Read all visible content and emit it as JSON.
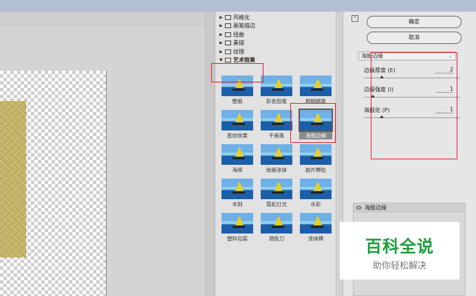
{
  "tree": [
    {
      "label": "风格化",
      "open": false
    },
    {
      "label": "画笔描边",
      "open": false
    },
    {
      "label": "扭曲",
      "open": false
    },
    {
      "label": "素描",
      "open": false
    },
    {
      "label": "纹理",
      "open": false
    },
    {
      "label": "艺术效果",
      "open": true
    }
  ],
  "thumbnails": [
    {
      "label": "壁画"
    },
    {
      "label": "彩色铅笔"
    },
    {
      "label": "粗糙蜡笔"
    },
    {
      "label": "底纹效果"
    },
    {
      "label": "干画笔"
    },
    {
      "label": "海报边缘",
      "selected": true
    },
    {
      "label": "海绵"
    },
    {
      "label": "绘画涂抹"
    },
    {
      "label": "胶片颗粒"
    },
    {
      "label": "木刻"
    },
    {
      "label": "霓虹灯光"
    },
    {
      "label": "水彩"
    },
    {
      "label": "塑料包装"
    },
    {
      "label": "调色刀"
    },
    {
      "label": "涂抹棒"
    }
  ],
  "buttons": {
    "ok": "确定",
    "cancel": "取消"
  },
  "filter_select": "海报边缘",
  "params": [
    {
      "label": "边缘厚度 (E)",
      "value": "2",
      "level": 0.2
    },
    {
      "label": "边缘强度 (I)",
      "value": "1",
      "level": 0.1
    },
    {
      "label": "海报化 (P)",
      "value": "1",
      "level": 0.2
    }
  ],
  "layer_label": "海报边缘",
  "watermark": {
    "title": "百科全说",
    "subtitle": "助你轻松解决"
  },
  "colors": {
    "highlight": "#e02020",
    "watermark_green": "#1d9c3b"
  }
}
